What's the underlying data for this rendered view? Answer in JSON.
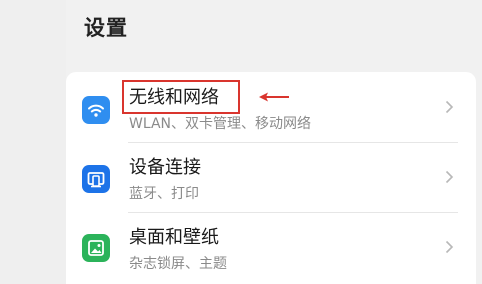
{
  "page": {
    "title": "设置"
  },
  "settings": {
    "items": [
      {
        "label": "无线和网络",
        "subtitle": "WLAN、双卡管理、移动网络",
        "icon": "wifi-icon",
        "icon_color": "#2f8ef0"
      },
      {
        "label": "设备连接",
        "subtitle": "蓝牙、打印",
        "icon": "device-connection-icon",
        "icon_color": "#1d73e8"
      },
      {
        "label": "桌面和壁纸",
        "subtitle": "杂志锁屏、主题",
        "icon": "wallpaper-icon",
        "icon_color": "#2bb35a"
      }
    ]
  },
  "annotation": {
    "highlight_color": "#d9352e",
    "arrow_icon": "arrow-left-icon"
  }
}
